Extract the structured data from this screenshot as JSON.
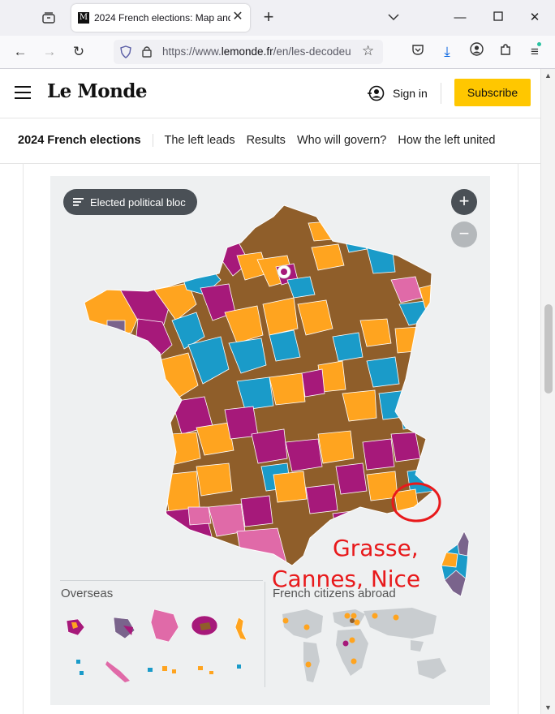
{
  "browser": {
    "tab_title": "2024 French elections: Map and",
    "favicon_letter": "M",
    "url_prefix": "https://www.",
    "url_domain": "lemonde.fr",
    "url_path": "/en/les-decodeu"
  },
  "header": {
    "logo": "Le Monde",
    "sign_in": "Sign in",
    "subscribe": "Subscribe"
  },
  "subnav": {
    "title": "2024 French elections",
    "links": [
      "The left leads",
      "Results",
      "Who will govern?",
      "How the left united"
    ]
  },
  "map": {
    "legend_label": "Elected political bloc",
    "zoom_in": "+",
    "zoom_out": "−",
    "overseas_title": "Overseas",
    "abroad_title": "French citizens abroad",
    "colors": {
      "left": "#a6197a",
      "center": "#ffa41f",
      "far_right": "#8f5e2a",
      "right": "#1a9bc9",
      "other": "#e06aa8",
      "regional": "#7a648c"
    }
  },
  "annotation": {
    "line1": "Grasse,",
    "line2": "Cannes, Nice",
    "color": "#e8191b"
  }
}
